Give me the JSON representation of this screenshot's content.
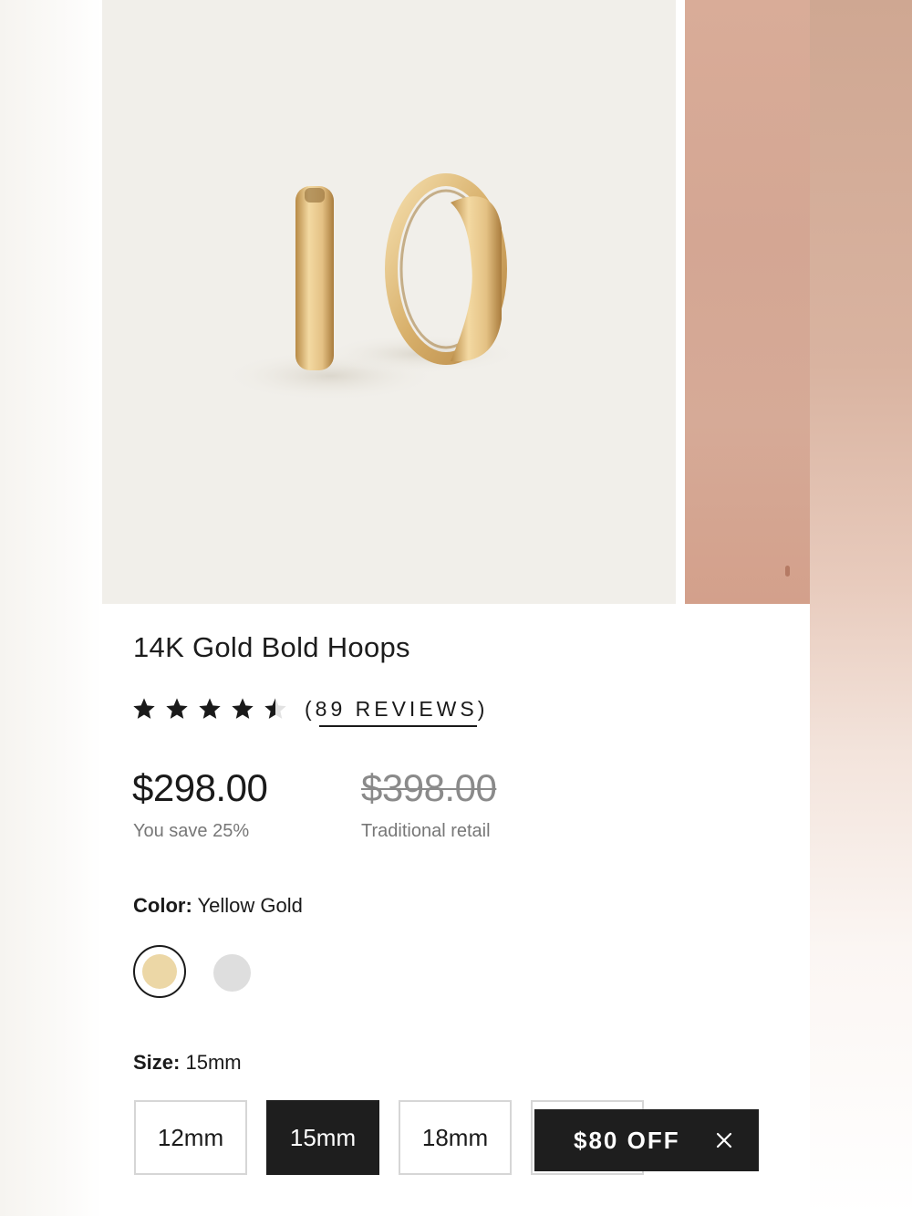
{
  "product": {
    "title": "14K Gold Bold Hoops",
    "rating": 4.5,
    "reviews_label": "(89 REVIEWS)",
    "price": "$298.00",
    "savings": "You save 25%",
    "retail_price": "$398.00",
    "retail_label": "Traditional retail"
  },
  "color": {
    "label": "Color:",
    "value": "Yellow Gold",
    "options": [
      {
        "name": "Yellow Gold",
        "hex": "#ecd7a6",
        "selected": true
      },
      {
        "name": "Silver",
        "hex": "#dedede",
        "selected": false
      }
    ]
  },
  "size": {
    "label": "Size:",
    "value": "15mm",
    "options": [
      "12mm",
      "15mm",
      "18mm",
      ""
    ]
  },
  "promo": {
    "label": "$80 OFF"
  },
  "colors": {
    "image_bg": "#f1efea",
    "gold": "#d9b773",
    "skin": "#d6aa97",
    "dark": "#1e1e1e"
  }
}
